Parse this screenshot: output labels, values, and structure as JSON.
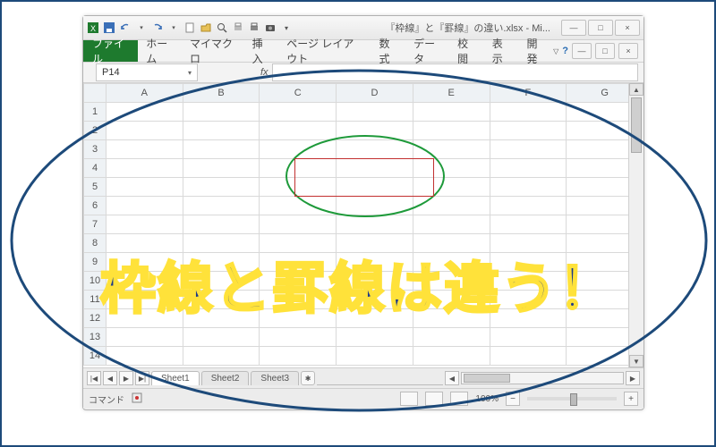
{
  "window": {
    "title": "『枠線』と『罫線』の違い.xlsx - Mi...",
    "buttons": {
      "min": "—",
      "max": "□",
      "close": "×",
      "doc_min": "—",
      "doc_max": "□",
      "doc_close": "×"
    }
  },
  "qat": {
    "icons": [
      "excel",
      "save",
      "undo",
      "redo",
      "new",
      "open",
      "print-preview",
      "quick-print",
      "print",
      "camera",
      "more"
    ]
  },
  "ribbon": {
    "file": "ファイル",
    "tabs": [
      "ホーム",
      "マイマクロ",
      "挿入",
      "ページ レイアウト",
      "数式",
      "データ",
      "校閲",
      "表示",
      "開発"
    ],
    "help": "?"
  },
  "formula_bar": {
    "cell_ref": "P14",
    "fx": "fx"
  },
  "sheet": {
    "columns": [
      "A",
      "B",
      "C",
      "D",
      "E",
      "F",
      "G"
    ],
    "rows": [
      "1",
      "2",
      "3",
      "4",
      "5",
      "6",
      "7",
      "8",
      "9",
      "10",
      "11",
      "12",
      "13",
      "14"
    ],
    "selected_row": "14"
  },
  "sheet_tabs": {
    "nav": [
      "|◀",
      "◀",
      "▶",
      "▶|"
    ],
    "tabs": [
      "Sheet1",
      "Sheet2",
      "Sheet3"
    ],
    "active": 0,
    "add": "+"
  },
  "status": {
    "mode": "コマンド",
    "record": "",
    "zoom": "100%",
    "minus": "−",
    "plus": "+"
  },
  "overlay": {
    "headline": "枠線と罫線は違う！"
  }
}
